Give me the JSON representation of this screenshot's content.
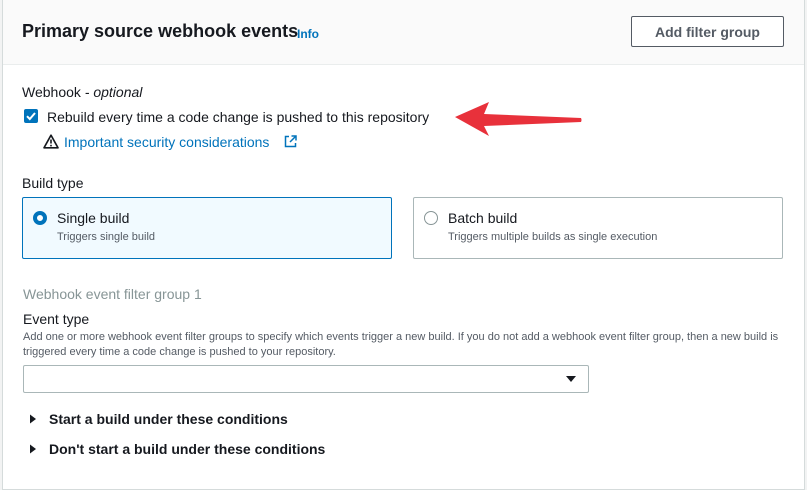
{
  "header": {
    "title": "Primary source webhook events",
    "info_label": "Info",
    "add_filter_group_label": "Add filter group"
  },
  "webhook": {
    "label": "Webhook",
    "optional_label": " - optional",
    "rebuild_checkbox_label": "Rebuild every time a code change is pushed to this repository",
    "rebuild_checked": true,
    "security_link_label": "Important security considerations"
  },
  "build_type": {
    "label": "Build type",
    "options": [
      {
        "title": "Single build",
        "description": "Triggers single build",
        "selected": true
      },
      {
        "title": "Batch build",
        "description": "Triggers multiple builds as single execution",
        "selected": false
      }
    ]
  },
  "filter_group": {
    "title": "Webhook event filter group 1",
    "event_type_label": "Event type",
    "event_type_description": "Add one or more webhook event filter groups to specify which events trigger a new build. If you do not add a webhook event filter group, then a new build is triggered every time a code change is pushed to your repository.",
    "event_type_value": "",
    "start_conditions_label": "Start a build under these conditions",
    "dont_start_conditions_label": "Don't start a build under these conditions"
  },
  "colors": {
    "accent": "#0073bb",
    "annotation_arrow": "#e8313b"
  },
  "icons": [
    "check-icon",
    "warning-icon",
    "external-link-icon",
    "caret-down-icon",
    "caret-right-icon",
    "annotation-arrow"
  ]
}
